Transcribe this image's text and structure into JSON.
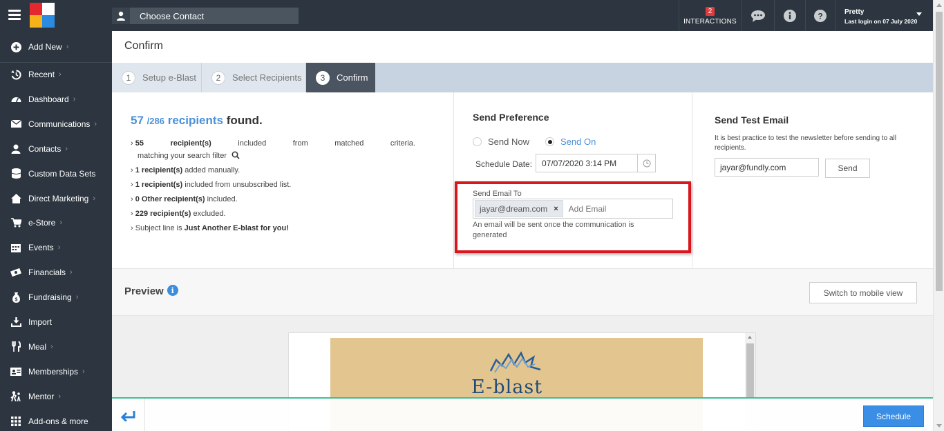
{
  "topbar": {
    "choose_contact": "Choose Contact",
    "interactions_count": "2",
    "interactions_label": "INTERACTIONS",
    "user_name": "Pretty",
    "last_login": "Last login on 07 July 2020"
  },
  "sidebar": {
    "add_new": "Add New",
    "items": [
      {
        "label": "Recent",
        "icon": "history-icon",
        "chevron": true
      },
      {
        "label": "Dashboard",
        "icon": "dashboard-icon",
        "chevron": true
      },
      {
        "label": "Communications",
        "icon": "envelope-icon",
        "chevron": true
      },
      {
        "label": "Contacts",
        "icon": "user-icon",
        "chevron": true
      },
      {
        "label": "Custom Data Sets",
        "icon": "database-icon",
        "chevron": false
      },
      {
        "label": "Direct Marketing",
        "icon": "house-icon",
        "chevron": true
      },
      {
        "label": "e-Store",
        "icon": "cart-icon",
        "chevron": true
      },
      {
        "label": "Events",
        "icon": "calendar-icon",
        "chevron": true
      },
      {
        "label": "Financials",
        "icon": "money-icon",
        "chevron": true
      },
      {
        "label": "Fundraising",
        "icon": "money-bag-icon",
        "chevron": true
      },
      {
        "label": "Import",
        "icon": "import-icon",
        "chevron": false
      },
      {
        "label": "Meal",
        "icon": "utensils-icon",
        "chevron": true
      },
      {
        "label": "Memberships",
        "icon": "id-card-icon",
        "chevron": true
      },
      {
        "label": "Mentor",
        "icon": "mentor-icon",
        "chevron": true
      },
      {
        "label": "Add-ons & more",
        "icon": "grid-icon",
        "chevron": false
      }
    ]
  },
  "page": {
    "title": "Confirm",
    "steps": [
      {
        "num": "1",
        "label": "Setup e-Blast"
      },
      {
        "num": "2",
        "label": "Select Recipients"
      },
      {
        "num": "3",
        "label": "Confirm"
      }
    ]
  },
  "summary": {
    "found_count": "57",
    "found_total": "/286",
    "found_word": "recipients",
    "found_suffix": "found.",
    "line1": [
      "55",
      "recipient(s)",
      "included",
      "from",
      "matched",
      "criteria."
    ],
    "line1_sub": "matching your search filter",
    "line2_bold": "1 recipient(s)",
    "line2_rest": " added manually.",
    "line3_bold": "1 recipient(s)",
    "line3_rest": " included from unsubscribed list.",
    "line4_bold": "0 Other recipient(s)",
    "line4_rest": " included.",
    "line5_bold": "229 recipient(s)",
    "line5_rest": " excluded.",
    "line6_pre": "Subject line is ",
    "line6_bold": "Just Another E-blast for you!"
  },
  "send_preference": {
    "title": "Send Preference",
    "option_now": "Send Now",
    "option_on": "Send On",
    "selected": "Send On",
    "schedule_label": "Schedule Date:",
    "schedule_value": "07/07/2020 3:14 PM",
    "send_to_label": "Send Email To",
    "recipient_chip": "jayar@dream.com",
    "add_email_placeholder": "Add Email",
    "note": "An email will be sent once the communication is generated"
  },
  "test_email": {
    "title": "Send Test Email",
    "desc": "It is best practice to test the newsletter before sending to all recipients.",
    "value": "jayar@fundly.com",
    "send_label": "Send"
  },
  "preview": {
    "title": "Preview",
    "mobile_button": "Switch to mobile view",
    "banner_text": "E-blast"
  },
  "footer": {
    "schedule_label": "Schedule"
  },
  "colors": {
    "dark_nav": "#2d3640",
    "accent_blue": "#3a8ee6",
    "highlight_red": "#d9151d",
    "divider_green": "#3dbf95"
  }
}
